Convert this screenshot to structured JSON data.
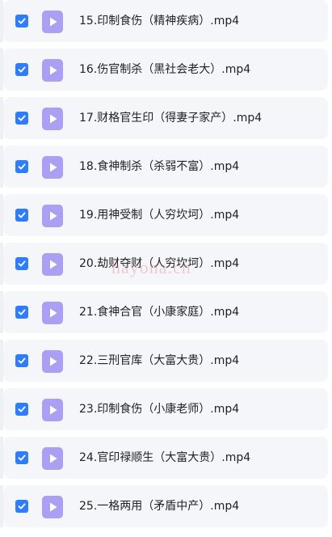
{
  "files": [
    {
      "name": "15.印制食伤（精神疾病）.mp4",
      "checked": true
    },
    {
      "name": "16.伤官制杀（黑社会老大）.mp4",
      "checked": true
    },
    {
      "name": "17.财格官生印（得妻子家产）.mp4",
      "checked": true
    },
    {
      "name": "18.食神制杀（杀弱不富）.mp4",
      "checked": true
    },
    {
      "name": "19.用神受制（人穷坎坷）.mp4",
      "checked": true
    },
    {
      "name": "20.劫财夺财（人穷坎坷）.mp4",
      "checked": true
    },
    {
      "name": "21.食神合官（小康家庭）.mp4",
      "checked": true
    },
    {
      "name": "22.三刑官库（大富大贵）.mp4",
      "checked": true
    },
    {
      "name": "23.印制食伤（小康老师）.mp4",
      "checked": true
    },
    {
      "name": "24.官印禄顺生（大富大贵）.mp4",
      "checked": true
    },
    {
      "name": "25.一格两用（矛盾中产）.mp4",
      "checked": true
    }
  ],
  "watermark": "hayona.cn",
  "colors": {
    "checkbox": "#2f7dff",
    "file_icon": "#a9a0f4",
    "row_background": "#f5f6fa"
  }
}
